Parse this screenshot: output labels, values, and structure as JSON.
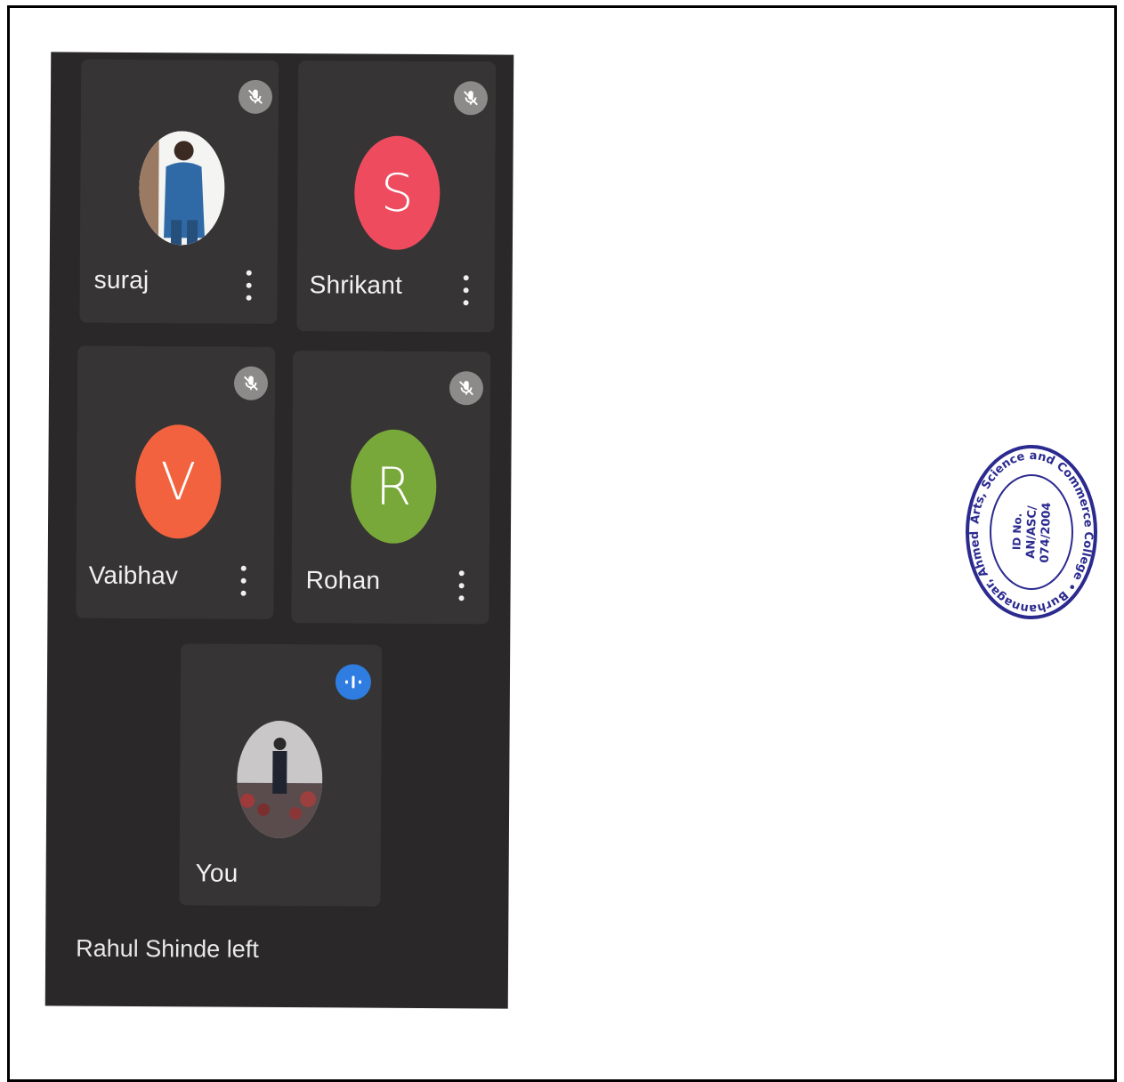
{
  "participants": [
    {
      "name": "suraj",
      "avatar_type": "photo",
      "mic_state": "muted",
      "menu_icon": "more-vert-icon"
    },
    {
      "name": "Shrikant",
      "avatar_type": "initial",
      "initial": "S",
      "avatar_color": "#ee4b5f",
      "mic_state": "muted",
      "menu_icon": "more-vert-icon"
    },
    {
      "name": "Vaibhav",
      "avatar_type": "initial",
      "initial": "V",
      "avatar_color": "#f2623e",
      "mic_state": "muted",
      "menu_icon": "more-vert-icon"
    },
    {
      "name": "Rohan",
      "avatar_type": "initial",
      "initial": "R",
      "avatar_color": "#79a83a",
      "mic_state": "muted",
      "menu_icon": "more-vert-icon"
    }
  ],
  "self_tile": {
    "name": "You",
    "avatar_type": "photo",
    "mic_state": "speaking",
    "indicator_color": "#2f7de0"
  },
  "toast": {
    "text": "Rahul Shinde left"
  },
  "seal": {
    "outer_text": "Arts, Science and Commerce College • Burhannagar, Ahmednagar •",
    "line1": "ID No.",
    "line2": "AN/ASC/",
    "line3": "074/2004",
    "color": "#2b2a8f"
  },
  "colors": {
    "call_background": "#2a2828",
    "tile_background": "#363434",
    "muted_icon_bg": "#8d8a8a"
  }
}
